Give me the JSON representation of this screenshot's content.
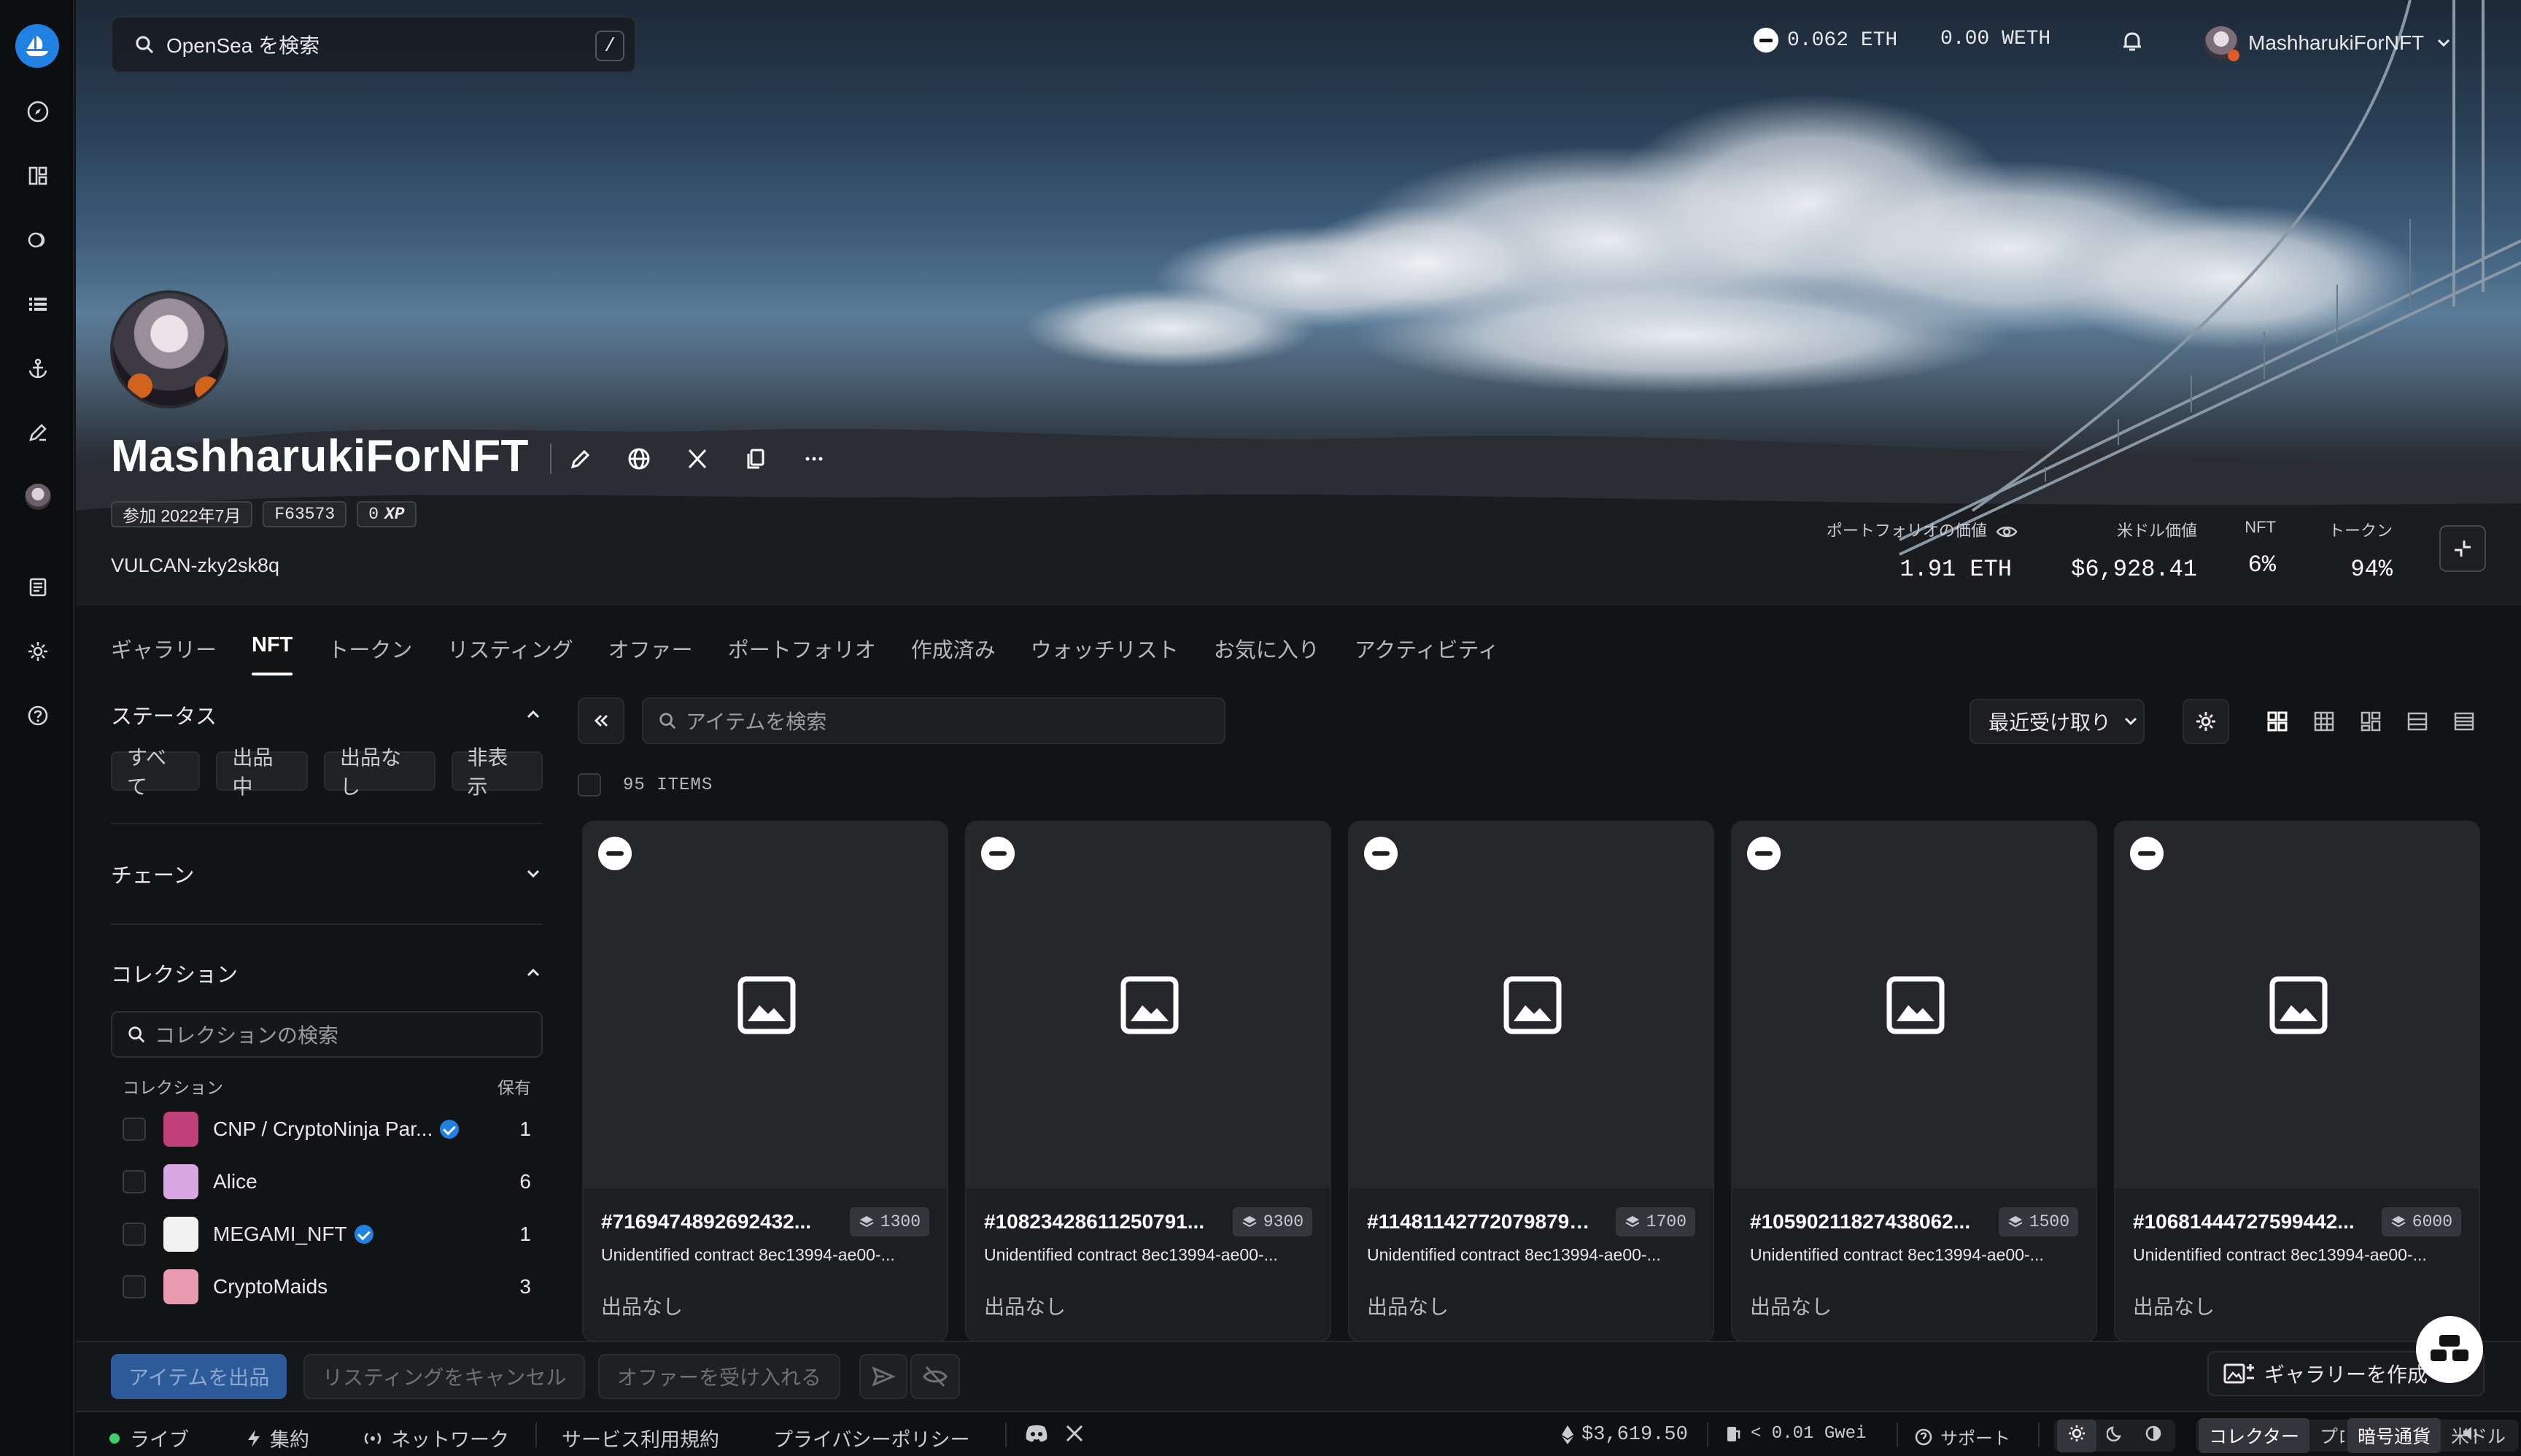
{
  "header": {
    "search_placeholder": "OpenSea を検索",
    "search_shortcut": "/",
    "eth_balance": "0.062 ETH",
    "weth_balance": "0.00 WETH",
    "username": "MashharukiForNFT"
  },
  "profile": {
    "name": "MashharukiForNFT",
    "joined": "参加 2022年7月",
    "code": "F63573",
    "xp_value": "0",
    "xp_label": "XP",
    "handle": "VULCAN-zky2sk8q"
  },
  "stats": {
    "portfolio_label": "ポートフォリオの価値",
    "portfolio_value": "1.91 ETH",
    "usd_label": "米ドル価値",
    "usd_value": "$6,928.41",
    "nft_label": "NFT",
    "nft_value": "6%",
    "token_label": "トークン",
    "token_value": "94%"
  },
  "tabs": [
    "ギャラリー",
    "NFT",
    "トークン",
    "リスティング",
    "オファー",
    "ポートフォリオ",
    "作成済み",
    "ウォッチリスト",
    "お気に入り",
    "アクティビティ"
  ],
  "filters": {
    "status_title": "ステータス",
    "status_buttons": [
      "すべて",
      "出品中",
      "出品なし",
      "非表示"
    ],
    "chain_title": "チェーン",
    "collection_title": "コレクション",
    "collection_search_placeholder": "コレクションの検索",
    "collection_col_name": "コレクション",
    "collection_col_count": "保有",
    "collections": [
      {
        "name": "CNP / CryptoNinja Par...",
        "count": "1",
        "verified": true,
        "color": "#c0417a"
      },
      {
        "name": "Alice",
        "count": "6",
        "verified": false,
        "color": "#d8a6e0"
      },
      {
        "name": "MEGAMI_NFT",
        "count": "1",
        "verified": true,
        "color": "#f2f2f2"
      },
      {
        "name": "CryptoMaids",
        "count": "3",
        "verified": false,
        "color": "#e89ab0"
      }
    ]
  },
  "toolbar": {
    "item_search_placeholder": "アイテムを検索",
    "sort_label": "最近受け取り",
    "items_count": "95 ITEMS"
  },
  "cards": [
    {
      "id": "#7169474892692432...",
      "rank": "1300",
      "contract": "Unidentified contract 8ec13994-ae00-...",
      "status": "出品なし"
    },
    {
      "id": "#10823428611250791...",
      "rank": "9300",
      "contract": "Unidentified contract 8ec13994-ae00-...",
      "status": "出品なし"
    },
    {
      "id": "#11481142772079879​5...",
      "rank": "1700",
      "contract": "Unidentified contract 8ec13994-ae00-...",
      "status": "出品なし"
    },
    {
      "id": "#10590211827438062...",
      "rank": "1500",
      "contract": "Unidentified contract 8ec13994-ae00-...",
      "status": "出品なし"
    },
    {
      "id": "#10681444727599442...",
      "rank": "6000",
      "contract": "Unidentified contract 8ec13994-ae00-...",
      "status": "出品なし"
    }
  ],
  "actions": {
    "list_items": "アイテムを出品",
    "cancel_listing": "リスティングをキャンセル",
    "accept_offer": "オファーを受け入れる",
    "create_gallery": "ギャラリーを作成"
  },
  "footer": {
    "live": "ライブ",
    "aggregate": "集約",
    "network": "ネットワーク",
    "terms": "サービス利用規約",
    "privacy": "プライバシーポリシー",
    "eth_price": "$3,619.50",
    "gas": "< 0.01 Gwei",
    "support": "サポート",
    "mode_collector": "コレクター",
    "mode_pro": "プロ",
    "currency_crypto": "暗号通貨",
    "currency_usd": "米ドル"
  }
}
